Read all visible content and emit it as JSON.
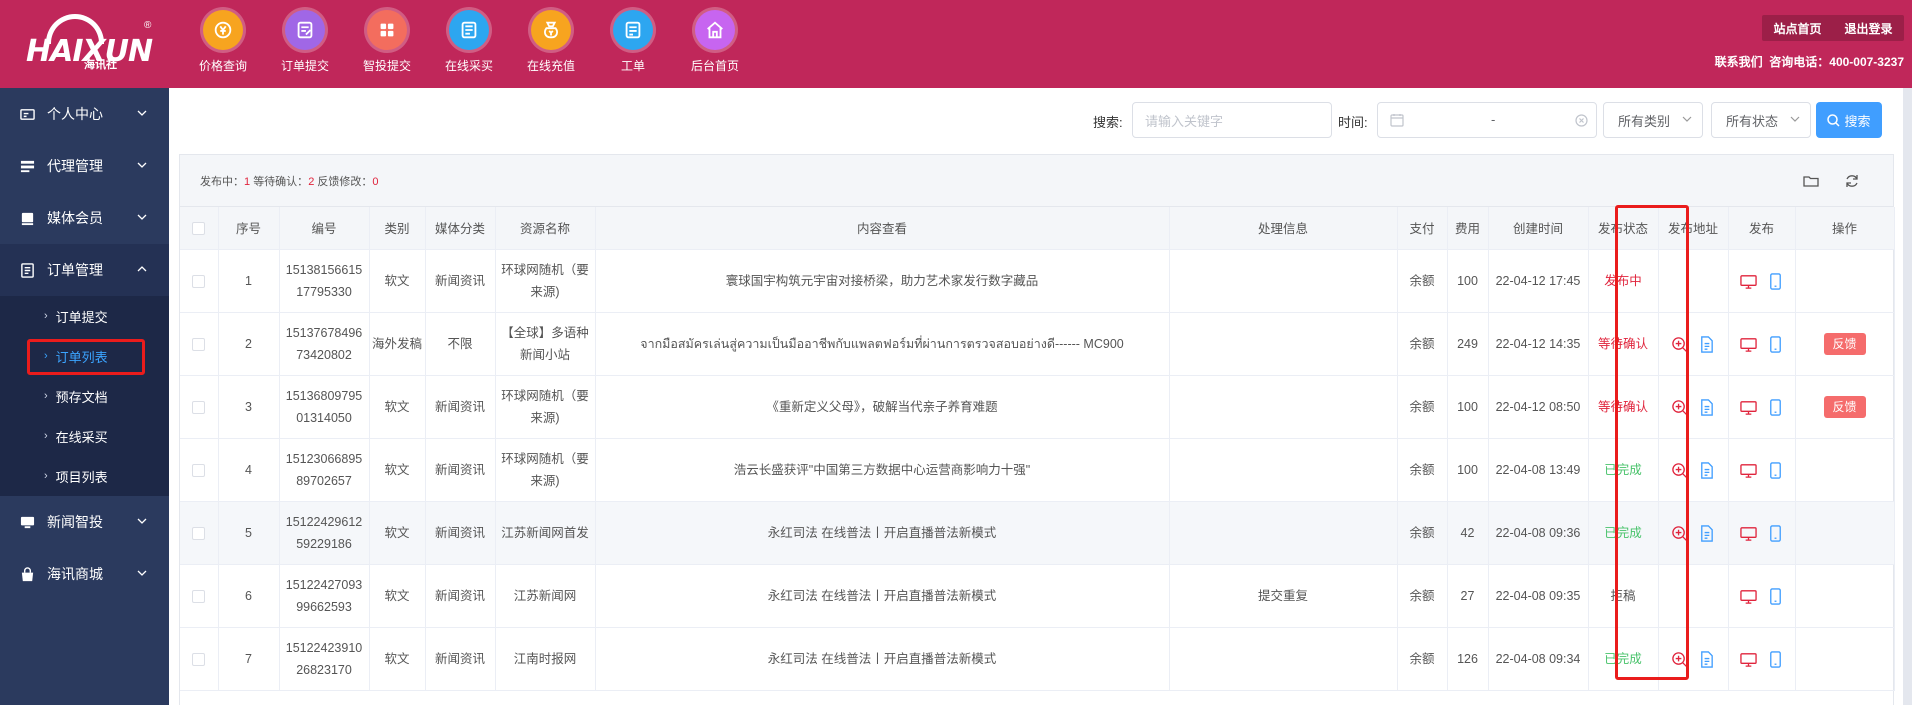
{
  "brand": {
    "name": "HAIXUN",
    "cn": "海讯社",
    "reg": "®"
  },
  "topnav": [
    {
      "label": "价格查询",
      "icon": "price-query-icon"
    },
    {
      "label": "订单提交",
      "icon": "order-submit-icon"
    },
    {
      "label": "智投提交",
      "icon": "smart-submit-icon"
    },
    {
      "label": "在线采买",
      "icon": "online-purchase-icon"
    },
    {
      "label": "在线充值",
      "icon": "online-recharge-icon"
    },
    {
      "label": "工单",
      "icon": "ticket-icon"
    },
    {
      "label": "后台首页",
      "icon": "home-icon"
    }
  ],
  "header_right": {
    "site_home": "站点首页",
    "logout": "退出登录",
    "contact_label": "联系我们",
    "hotline": "咨询电话：400-007-3237"
  },
  "sidebar": {
    "items": [
      {
        "label": "个人中心"
      },
      {
        "label": "代理管理"
      },
      {
        "label": "媒体会员"
      },
      {
        "label": "订单管理"
      },
      {
        "label": "新闻智投"
      },
      {
        "label": "海讯商城"
      }
    ],
    "subitems": [
      {
        "label": "订单提交"
      },
      {
        "label": "订单列表"
      },
      {
        "label": "预存文档"
      },
      {
        "label": "在线采买"
      },
      {
        "label": "项目列表"
      }
    ]
  },
  "search": {
    "label": "搜索:",
    "placeholder": "请输入关键字",
    "time_label": "时间:",
    "date_sep": "-",
    "category": "所有类别",
    "status": "所有状态",
    "button": "搜索"
  },
  "stats": {
    "publishing_label": "发布中：",
    "publishing": "1",
    "waiting_label": "等待确认：",
    "waiting": "2",
    "feedback_label": "反馈修改：",
    "feedback": "0"
  },
  "table": {
    "headers": [
      "序号",
      "编号",
      "类别",
      "媒体分类",
      "资源名称",
      "内容查看",
      "处理信息",
      "支付",
      "费用",
      "创建时间",
      "发布状态",
      "发布地址",
      "发布",
      "操作"
    ],
    "rows": [
      {
        "seq": "1",
        "id1": "15138156615",
        "id2": "17795330",
        "cat": "软文",
        "media": "新闻资讯",
        "res": "环球网随机（要来源)",
        "content": "寰球国宇构筑元宇宙对接桥梁，助力艺术家发行数字藏品",
        "info": "",
        "pay": "余额",
        "fee": "100",
        "time": "22-04-12 17:45",
        "status": "发布中",
        "status_color": "#e0243c",
        "addr": false,
        "feedback": ""
      },
      {
        "seq": "2",
        "id1": "15137678496",
        "id2": "73420802",
        "cat": "海外发稿",
        "media": "不限",
        "res": "【全球】多语种新闻小站",
        "content": "จากมือสมัครเล่นสู่ความเป็นมืออาชีพกับแพลตฟอร์มที่ผ่านการตรวจสอบอย่างดี------ MC900",
        "info": "",
        "pay": "余额",
        "fee": "249",
        "time": "22-04-12 14:35",
        "status": "等待确认",
        "status_color": "#e0243c",
        "addr": true,
        "feedback": "反馈"
      },
      {
        "seq": "3",
        "id1": "15136809795",
        "id2": "01314050",
        "cat": "软文",
        "media": "新闻资讯",
        "res": "环球网随机（要来源)",
        "content": "《重新定义父母》，破解当代亲子养育难题",
        "info": "",
        "pay": "余额",
        "fee": "100",
        "time": "22-04-12 08:50",
        "status": "等待确认",
        "status_color": "#e0243c",
        "addr": true,
        "feedback": "反馈"
      },
      {
        "seq": "4",
        "id1": "15123066895",
        "id2": "89702657",
        "cat": "软文",
        "media": "新闻资讯",
        "res": "环球网随机（要来源)",
        "content": "浩云长盛获评\"中国第三方数据中心运营商影响力十强\"",
        "info": "",
        "pay": "余额",
        "fee": "100",
        "time": "22-04-08 13:49",
        "status": "已完成",
        "status_color": "#49c36b",
        "addr": true,
        "feedback": ""
      },
      {
        "seq": "5",
        "id1": "15122429612",
        "id2": "59229186",
        "cat": "软文",
        "media": "新闻资讯",
        "res": "江苏新闻网首发",
        "content": "永红司法 在线普法丨开启直播普法新模式",
        "info": "",
        "pay": "余额",
        "fee": "42",
        "time": "22-04-08 09:36",
        "status": "已完成",
        "status_color": "#49c36b",
        "addr": true,
        "feedback": ""
      },
      {
        "seq": "6",
        "id1": "15122427093",
        "id2": "99662593",
        "cat": "软文",
        "media": "新闻资讯",
        "res": "江苏新闻网",
        "content": "永红司法 在线普法丨开启直播普法新模式",
        "info": "提交重复",
        "pay": "余额",
        "fee": "27",
        "time": "22-04-08 09:35",
        "status": "拒稿",
        "status_color": "#555555",
        "addr": false,
        "feedback": ""
      },
      {
        "seq": "7",
        "id1": "15122423910",
        "id2": "26823170",
        "cat": "软文",
        "media": "新闻资讯",
        "res": "江南时报网",
        "content": "永红司法 在线普法丨开启直播普法新模式",
        "info": "",
        "pay": "余额",
        "fee": "126",
        "time": "22-04-08 09:34",
        "status": "已完成",
        "status_color": "#49c36b",
        "addr": true,
        "feedback": ""
      }
    ]
  },
  "colors": {
    "header": "#c0275a",
    "sidebar": "#2b3a5e",
    "accent": "#409eff",
    "danger": "#e0243c",
    "success": "#49c36b"
  }
}
